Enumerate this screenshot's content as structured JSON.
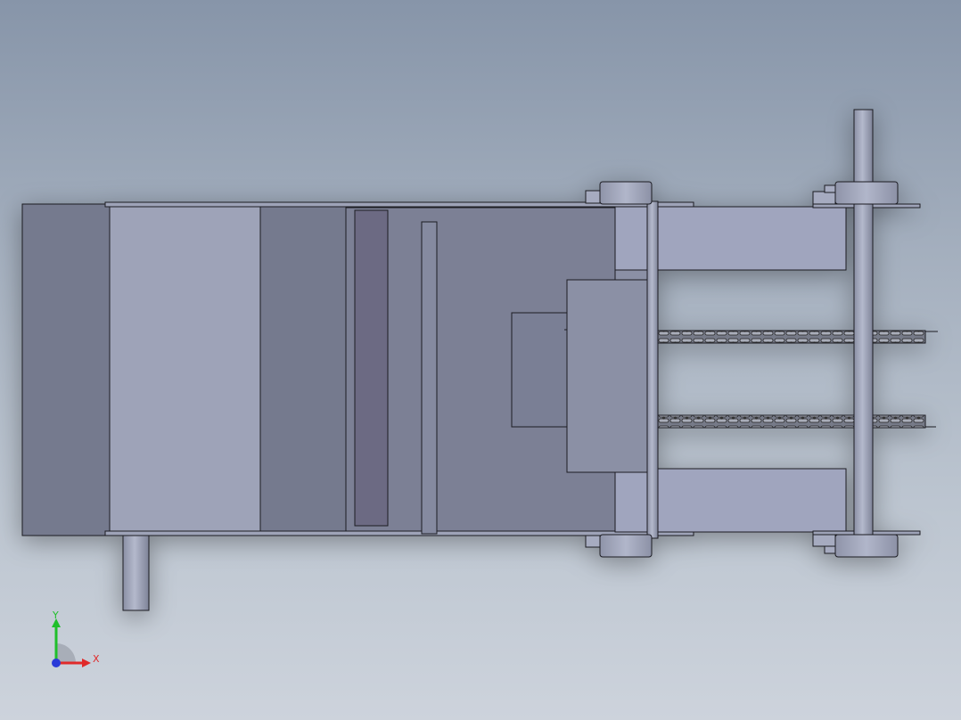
{
  "view": {
    "background_top": "#8795a9",
    "background_bottom": "#cdd3dc",
    "edge_color": "#1c1c24"
  },
  "colors": {
    "frame_dark": "#757a8e",
    "frame_light": "#9ea3b8",
    "frame_mid": "#7b8095",
    "plate_dark": "#6c6a83",
    "arm": "#a0a5be",
    "block": "#8b90a5",
    "block_inner": "#7a7f95",
    "shaft": "#9a9fb4",
    "bearing": "#a6abc0",
    "chain": "#5a5c66"
  },
  "triad": {
    "y_label": "Y",
    "x_label": "X",
    "y_color": "#1fbf2a",
    "x_color": "#e02a2a",
    "z_color": "#2a3ad8"
  }
}
